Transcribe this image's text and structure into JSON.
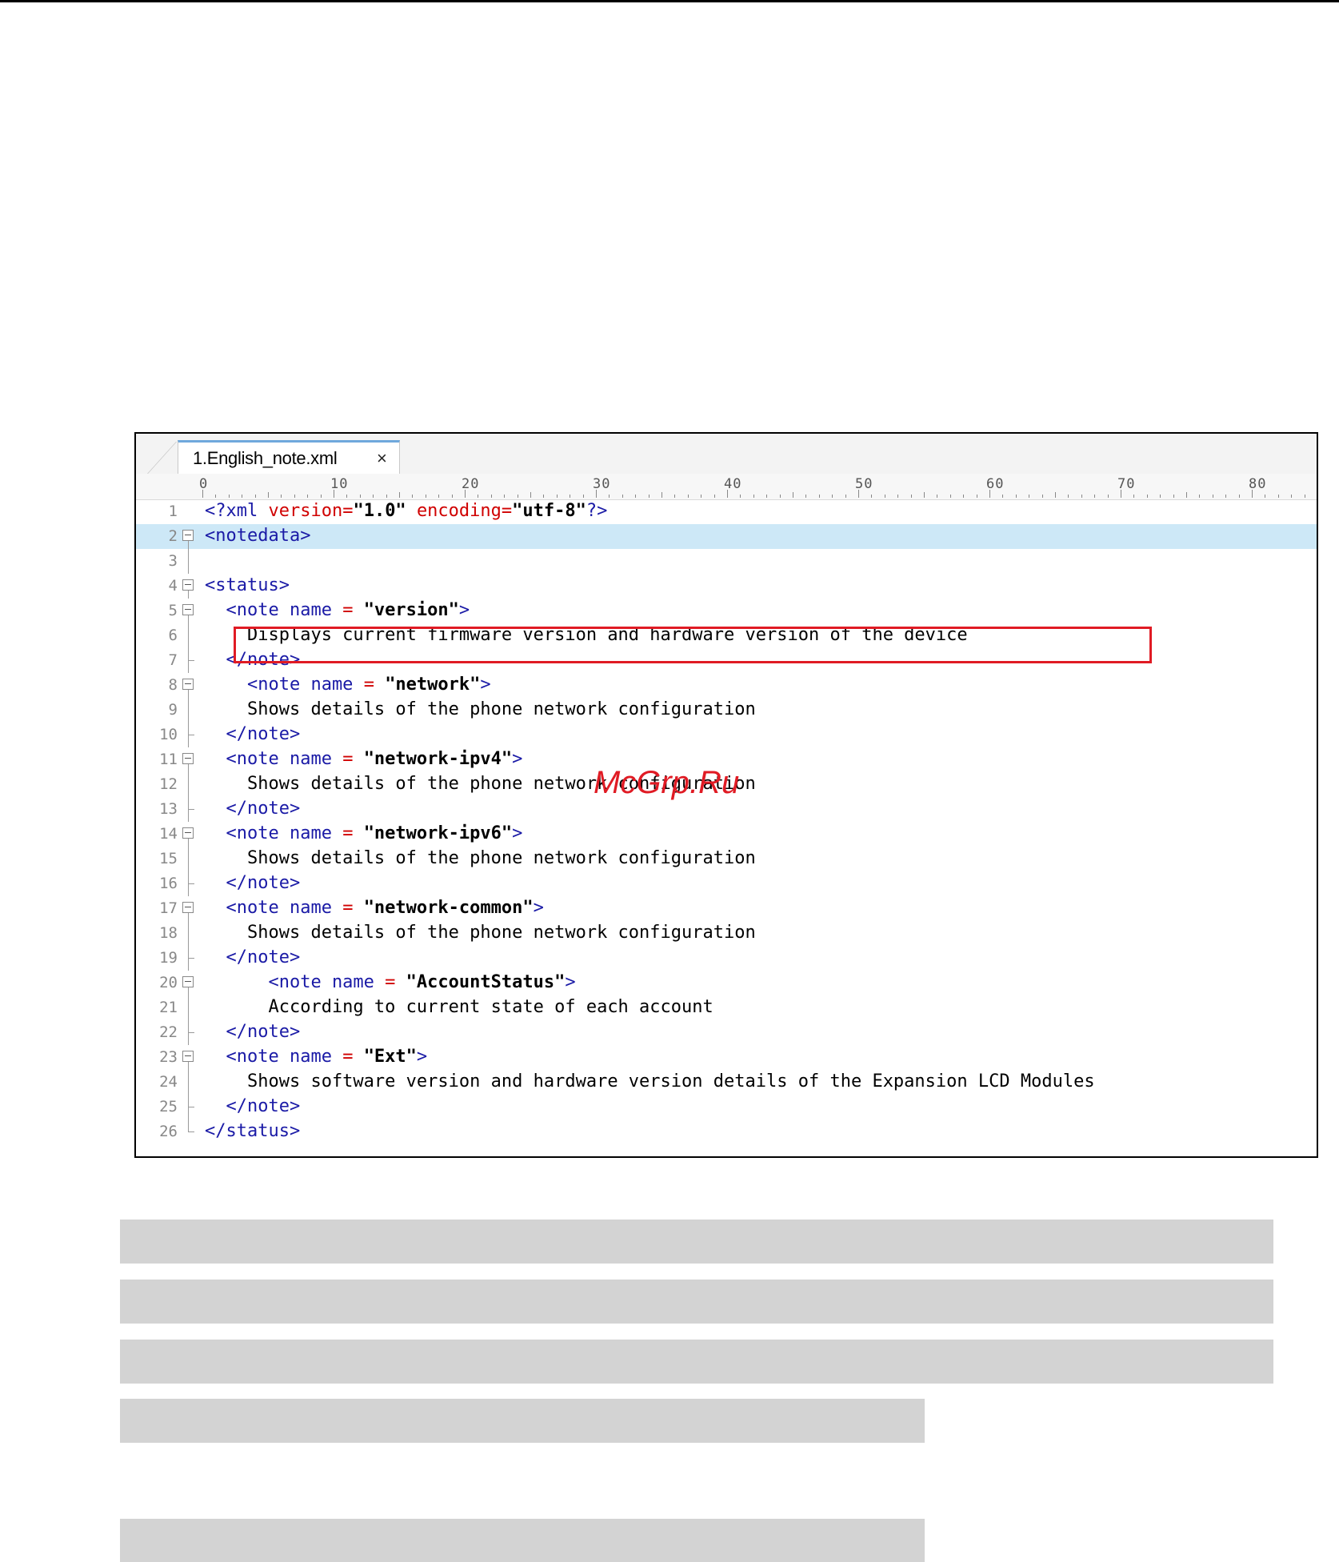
{
  "editor": {
    "tab": {
      "label": "1.English_note.xml",
      "close": "×"
    },
    "ruler": [
      "0",
      "10",
      "20",
      "30",
      "40",
      "50",
      "60",
      "70",
      "80"
    ],
    "lines": [
      {
        "num": "1",
        "fold": "none",
        "tokens": [
          {
            "t": "pi",
            "v": "<?xml "
          },
          {
            "t": "attr",
            "v": "version="
          },
          {
            "t": "str",
            "v": "\"1.0\" "
          },
          {
            "t": "attr",
            "v": "encoding="
          },
          {
            "t": "str",
            "v": "\"utf-8\""
          },
          {
            "t": "pi",
            "v": "?>"
          }
        ]
      },
      {
        "num": "2",
        "fold": "open",
        "current": true,
        "tokens": [
          {
            "t": "tag",
            "v": "<notedata>"
          }
        ]
      },
      {
        "num": "3",
        "fold": "line",
        "tokens": []
      },
      {
        "num": "4",
        "fold": "open",
        "tokens": [
          {
            "t": "tag",
            "v": "<status>"
          }
        ]
      },
      {
        "num": "5",
        "fold": "open",
        "tokens": [
          {
            "t": "tag",
            "v": "  <note name "
          },
          {
            "t": "attr",
            "v": "= "
          },
          {
            "t": "str",
            "v": "\"version\""
          },
          {
            "t": "tag",
            "v": ">"
          }
        ]
      },
      {
        "num": "6",
        "fold": "line",
        "tokens": [
          {
            "t": "text",
            "v": "    Displays current firmware version and hardware version of the device"
          }
        ]
      },
      {
        "num": "7",
        "fold": "end",
        "tokens": [
          {
            "t": "tag",
            "v": "  </note>"
          }
        ]
      },
      {
        "num": "8",
        "fold": "open",
        "tokens": [
          {
            "t": "tag",
            "v": "    <note name "
          },
          {
            "t": "attr",
            "v": "= "
          },
          {
            "t": "str",
            "v": "\"network\""
          },
          {
            "t": "tag",
            "v": ">"
          }
        ]
      },
      {
        "num": "9",
        "fold": "line",
        "tokens": [
          {
            "t": "text",
            "v": "    Shows details of the phone network configuration"
          }
        ]
      },
      {
        "num": "10",
        "fold": "end",
        "tokens": [
          {
            "t": "tag",
            "v": "  </note>"
          }
        ]
      },
      {
        "num": "11",
        "fold": "open",
        "tokens": [
          {
            "t": "tag",
            "v": "  <note name "
          },
          {
            "t": "attr",
            "v": "= "
          },
          {
            "t": "str",
            "v": "\"network-ipv4\""
          },
          {
            "t": "tag",
            "v": ">"
          }
        ]
      },
      {
        "num": "12",
        "fold": "line",
        "tokens": [
          {
            "t": "text",
            "v": "    Shows details of the phone network configuration"
          }
        ]
      },
      {
        "num": "13",
        "fold": "end",
        "tokens": [
          {
            "t": "tag",
            "v": "  </note>"
          }
        ]
      },
      {
        "num": "14",
        "fold": "open",
        "tokens": [
          {
            "t": "tag",
            "v": "  <note name "
          },
          {
            "t": "attr",
            "v": "= "
          },
          {
            "t": "str",
            "v": "\"network-ipv6\""
          },
          {
            "t": "tag",
            "v": ">"
          }
        ]
      },
      {
        "num": "15",
        "fold": "line",
        "tokens": [
          {
            "t": "text",
            "v": "    Shows details of the phone network configuration"
          }
        ]
      },
      {
        "num": "16",
        "fold": "end",
        "tokens": [
          {
            "t": "tag",
            "v": "  </note>"
          }
        ]
      },
      {
        "num": "17",
        "fold": "open",
        "tokens": [
          {
            "t": "tag",
            "v": "  <note name "
          },
          {
            "t": "attr",
            "v": "= "
          },
          {
            "t": "str",
            "v": "\"network-common\""
          },
          {
            "t": "tag",
            "v": ">"
          }
        ]
      },
      {
        "num": "18",
        "fold": "line",
        "tokens": [
          {
            "t": "text",
            "v": "    Shows details of the phone network configuration"
          }
        ]
      },
      {
        "num": "19",
        "fold": "end",
        "tokens": [
          {
            "t": "tag",
            "v": "  </note>"
          }
        ]
      },
      {
        "num": "20",
        "fold": "open",
        "tokens": [
          {
            "t": "tag",
            "v": "      <note name "
          },
          {
            "t": "attr",
            "v": "= "
          },
          {
            "t": "str",
            "v": "\"AccountStatus\""
          },
          {
            "t": "tag",
            "v": ">"
          }
        ]
      },
      {
        "num": "21",
        "fold": "line",
        "tokens": [
          {
            "t": "text",
            "v": "      According to current state of each account"
          }
        ]
      },
      {
        "num": "22",
        "fold": "end",
        "tokens": [
          {
            "t": "tag",
            "v": "  </note>"
          }
        ]
      },
      {
        "num": "23",
        "fold": "open",
        "tokens": [
          {
            "t": "tag",
            "v": "  <note name "
          },
          {
            "t": "attr",
            "v": "= "
          },
          {
            "t": "str",
            "v": "\"Ext\""
          },
          {
            "t": "tag",
            "v": ">"
          }
        ]
      },
      {
        "num": "24",
        "fold": "line",
        "tokens": [
          {
            "t": "text",
            "v": "    Shows software version and hardware version details of the Expansion LCD Modules"
          }
        ]
      },
      {
        "num": "25",
        "fold": "end",
        "tokens": [
          {
            "t": "tag",
            "v": "  </note>"
          }
        ]
      },
      {
        "num": "26",
        "fold": "end",
        "tokens": [
          {
            "t": "tag",
            "v": "</status>"
          }
        ]
      }
    ]
  },
  "watermark": "McGrp.Ru",
  "colors": {
    "highlight_border": "#e01b24",
    "current_line": "#cde8f7",
    "tag": "#1a1aa6",
    "attr": "#d00000",
    "redaction": "#d3d3d3"
  }
}
